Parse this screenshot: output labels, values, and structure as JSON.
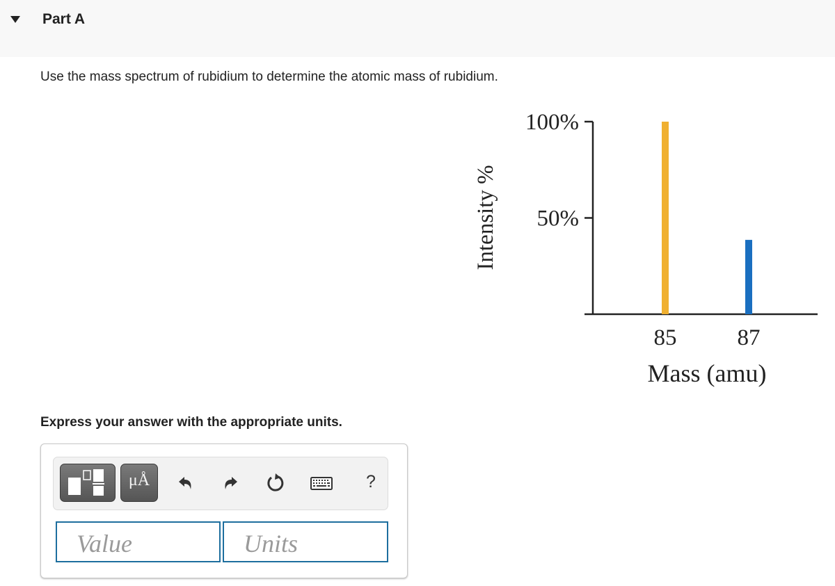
{
  "part": {
    "title": "Part A",
    "expanded": true
  },
  "question": {
    "text": "Use the mass spectrum of rubidium to determine the atomic mass of rubidium."
  },
  "chart_data": {
    "type": "bar",
    "title": "",
    "xlabel": "Mass (amu)",
    "ylabel": "Intensity %",
    "categories": [
      "85",
      "87"
    ],
    "x": [
      85,
      87
    ],
    "values": [
      100,
      38.6
    ],
    "bar_colors": [
      "#f0b030",
      "#1a6fc0"
    ],
    "yticks": [
      {
        "value": 50,
        "label": "50%"
      },
      {
        "value": 100,
        "label": "100%"
      }
    ],
    "ylim": [
      0,
      100
    ],
    "xlim": [
      83,
      88.5
    ],
    "grid": false,
    "legend": "none"
  },
  "instruction": {
    "text": "Express your answer with the appropriate units."
  },
  "answer": {
    "toolbar": {
      "template_button": "templates-icon",
      "units_button_label": "μÅ",
      "undo": "undo-icon",
      "redo": "redo-icon",
      "reset": "reset-icon",
      "keyboard": "keyboard-icon",
      "help_label": "?"
    },
    "value_field": {
      "placeholder": "Value",
      "value": ""
    },
    "units_field": {
      "placeholder": "Units",
      "value": ""
    }
  }
}
